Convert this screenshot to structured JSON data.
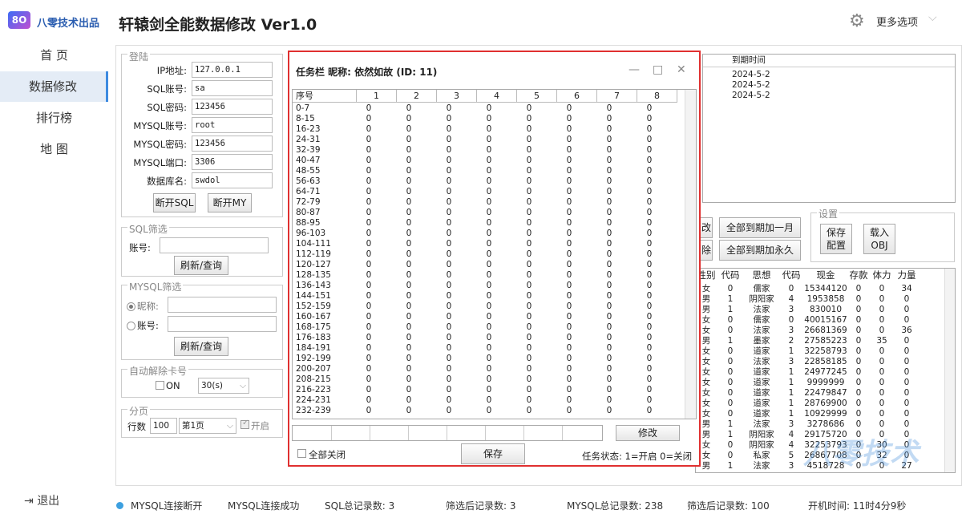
{
  "logo": {
    "mark": "8O",
    "text": "八零技术出品"
  },
  "nav": [
    "首 页",
    "数据修改",
    "排行榜",
    "地 图"
  ],
  "logout": "退出",
  "app_title": "轩辕剑全能数据修改  Ver1.0",
  "more_options": "更多选项",
  "login": {
    "title": "登陆",
    "fields": [
      {
        "label": "IP地址:",
        "value": "127.0.0.1"
      },
      {
        "label": "SQL账号:",
        "value": "sa"
      },
      {
        "label": "SQL密码:",
        "value": "123456"
      },
      {
        "label": "MYSQL账号:",
        "value": "root"
      },
      {
        "label": "MYSQL密码:",
        "value": "123456"
      },
      {
        "label": "MYSQL端口:",
        "value": "3306"
      },
      {
        "label": "数据库名:",
        "value": "swdol"
      }
    ],
    "btn_sql": "断开SQL",
    "btn_my": "断开MY"
  },
  "sql_filter": {
    "title": "SQL筛选",
    "account_label": "账号:",
    "refresh": "刷新/查询"
  },
  "mysql_filter": {
    "title": "MYSQL筛选",
    "nick_label": "昵称:",
    "account_label": "账号:",
    "refresh": "刷新/查询"
  },
  "auto_unlock": {
    "title": "自动解除卡号",
    "on_label": "ON",
    "interval": "30(s)"
  },
  "paging": {
    "title": "分页",
    "rows_label": "行数",
    "rows_value": "100",
    "page_value": "第1页",
    "enable_label": "开启"
  },
  "expire_table": {
    "header": "到期时间",
    "rows": [
      "2024-5-2",
      "2024-5-2",
      "2024-5-2"
    ]
  },
  "actions": {
    "partial1": "改",
    "partial2": "除",
    "add_month": "全部到期加一月",
    "add_forever": "全部到期加永久"
  },
  "settings": {
    "title": "设置",
    "save": "保存\n配置",
    "load": "载入\nOBJ"
  },
  "players": {
    "headers": [
      "性别",
      "代码",
      "思想",
      "代码",
      "现金",
      "存款",
      "体力",
      "力量"
    ],
    "rows": [
      [
        "女",
        "0",
        "儒家",
        "0",
        "15344120",
        "0",
        "0",
        "34"
      ],
      [
        "男",
        "1",
        "阴阳家",
        "4",
        "1953858",
        "0",
        "0",
        "0"
      ],
      [
        "男",
        "1",
        "法家",
        "3",
        "830010",
        "0",
        "0",
        "0"
      ],
      [
        "女",
        "0",
        "儒家",
        "0",
        "40015167",
        "0",
        "0",
        "0"
      ],
      [
        "女",
        "0",
        "法家",
        "3",
        "26681369",
        "0",
        "0",
        "36"
      ],
      [
        "男",
        "1",
        "墨家",
        "2",
        "27585223",
        "0",
        "35",
        "0"
      ],
      [
        "女",
        "0",
        "道家",
        "1",
        "32258793",
        "0",
        "0",
        "0"
      ],
      [
        "女",
        "0",
        "法家",
        "3",
        "22858185",
        "0",
        "0",
        "0"
      ],
      [
        "女",
        "0",
        "道家",
        "1",
        "24977245",
        "0",
        "0",
        "0"
      ],
      [
        "女",
        "0",
        "道家",
        "1",
        "9999999",
        "0",
        "0",
        "0"
      ],
      [
        "女",
        "0",
        "道家",
        "1",
        "22479847",
        "0",
        "0",
        "0"
      ],
      [
        "女",
        "0",
        "道家",
        "1",
        "28769900",
        "0",
        "0",
        "0"
      ],
      [
        "女",
        "0",
        "道家",
        "1",
        "10929999",
        "0",
        "0",
        "0"
      ],
      [
        "男",
        "1",
        "法家",
        "3",
        "3278686",
        "0",
        "0",
        "0"
      ],
      [
        "男",
        "1",
        "阴阳家",
        "4",
        "29175720",
        "0",
        "0",
        "0"
      ],
      [
        "女",
        "0",
        "阴阳家",
        "4",
        "32253793",
        "0",
        "30",
        "0"
      ],
      [
        "女",
        "0",
        "私家",
        "5",
        "26867708",
        "0",
        "32",
        "0"
      ],
      [
        "男",
        "1",
        "法家",
        "3",
        "4518728",
        "0",
        "0",
        "27"
      ]
    ]
  },
  "dialog": {
    "title": "任务栏    昵称: 依然如故 (ID: 11)",
    "min": "—",
    "max": "□",
    "close": "✕",
    "headers": [
      "序号",
      "1",
      "2",
      "3",
      "4",
      "5",
      "6",
      "7",
      "8"
    ],
    "rows": [
      "0-7",
      "8-15",
      "16-23",
      "24-31",
      "32-39",
      "40-47",
      "48-55",
      "56-63",
      "64-71",
      "72-79",
      "80-87",
      "88-95",
      "96-103",
      "104-111",
      "112-119",
      "120-127",
      "128-135",
      "136-143",
      "144-151",
      "152-159",
      "160-167",
      "168-175",
      "176-183",
      "184-191",
      "192-199",
      "200-207",
      "208-215",
      "216-223",
      "224-231",
      "232-239"
    ],
    "cell_value": "0",
    "modify": "修改",
    "close_all": "全部关闭",
    "save": "保存",
    "status_hint": "任务状态: 1=开启  0=关闭"
  },
  "status": {
    "mysql_disconnected": "MYSQL连接断开",
    "mysql_connected": "MYSQL连接成功",
    "sql_total": "SQL总记录数:  3",
    "filtered1": "筛选后记录数:  3",
    "mysql_total": "MYSQL总记录数:  238",
    "filtered2": "筛选后记录数:  100",
    "uptime": "开机时间:  11时4分9秒"
  },
  "watermark": "八零技术",
  "colors": {
    "accent": "#3d8ae0",
    "dialog_border": "#e03030"
  }
}
